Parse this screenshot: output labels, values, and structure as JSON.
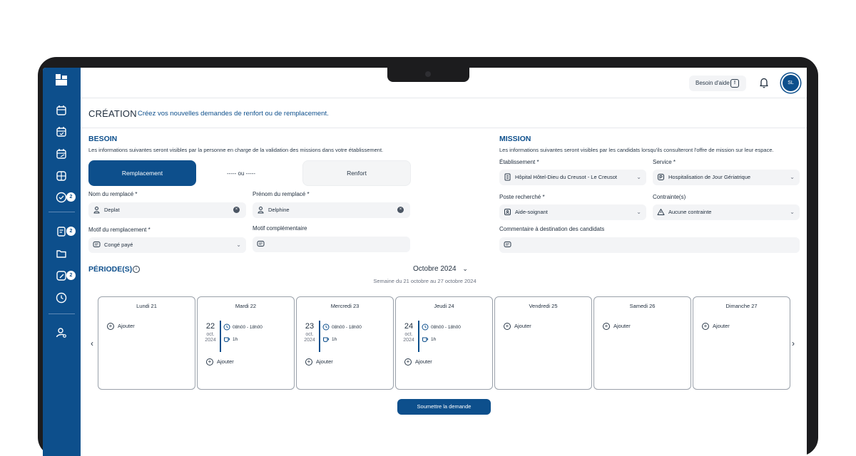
{
  "header": {
    "help_label": "Besoin d'aide",
    "avatar_initials": "SL",
    "title": "CRÉATION",
    "subtitle": "Créez vos nouvelles demandes de renfort ou de remplacement."
  },
  "sidebar": {
    "badges": [
      "2",
      "2",
      "2"
    ]
  },
  "besoin": {
    "title": "BESOIN",
    "description": "Les informations suivantes seront visibles par la personne en charge de la validation des missions dans votre établissement.",
    "toggle_left": "Remplacement",
    "toggle_or": "----- ou -----",
    "toggle_right": "Renfort",
    "nom_label": "Nom du remplacé *",
    "nom_value": "Deplat",
    "prenom_label": "Prénom du remplacé *",
    "prenom_value": "Delphine",
    "motif_label": "Motif du remplacement *",
    "motif_value": "Congé payé",
    "complement_label": "Motif complémentaire",
    "complement_value": ""
  },
  "mission": {
    "title": "MISSION",
    "description": "Les informations suivantes seront visibles par les candidats lorsqu'ils consulteront l'offre de mission sur leur espace.",
    "etablissement_label": "Établissement *",
    "etablissement_value": "Hôpital Hôtel-Dieu du Creusot - Le Creusot",
    "service_label": "Service *",
    "service_value": "Hospitalisation de Jour Gériatrique",
    "poste_label": "Poste recherché *",
    "poste_value": "Aide-soignant",
    "contraintes_label": "Contrainte(s)",
    "contraintes_value": "Aucune contrainte",
    "commentaire_label": "Commentaire à destination des candidats",
    "commentaire_value": ""
  },
  "periodes": {
    "title": "PÉRIODE(S)",
    "month": "Octobre 2024",
    "week": "Semaine du 21 octobre au 27 octobre 2024",
    "add_label": "Ajouter",
    "days": [
      {
        "label": "Lundi 21"
      },
      {
        "label": "Mardi 22",
        "slot": {
          "day": "22",
          "month": "oct.",
          "year": "2024",
          "hours": "08h00 - 18h00",
          "pause": "1h"
        }
      },
      {
        "label": "Mercredi 23",
        "slot": {
          "day": "23",
          "month": "oct.",
          "year": "2024",
          "hours": "08h00 - 18h00",
          "pause": "1h"
        }
      },
      {
        "label": "Jeudi 24",
        "slot": {
          "day": "24",
          "month": "oct.",
          "year": "2024",
          "hours": "08h00 - 18h00",
          "pause": "1h"
        }
      },
      {
        "label": "Vendredi 25"
      },
      {
        "label": "Samedi 26"
      },
      {
        "label": "Dimanche 27"
      }
    ],
    "submit_label": "Soumettre la demande"
  },
  "icons": [
    "logo-icon",
    "calendar-icon",
    "calendar-check-icon",
    "calendar-edit-icon",
    "grid-icon",
    "check-circle-icon",
    "document-icon",
    "folder-icon",
    "edit-icon",
    "clock-icon",
    "user-settings-icon",
    "bell-icon",
    "help-icon",
    "user-icon",
    "message-icon",
    "building-icon",
    "service-icon",
    "badge-icon",
    "warning-icon",
    "info-icon",
    "plus-circle-icon",
    "coffee-icon"
  ],
  "colors": {
    "brand": "#0d4f8c",
    "field_bg": "#f3f4f6"
  }
}
